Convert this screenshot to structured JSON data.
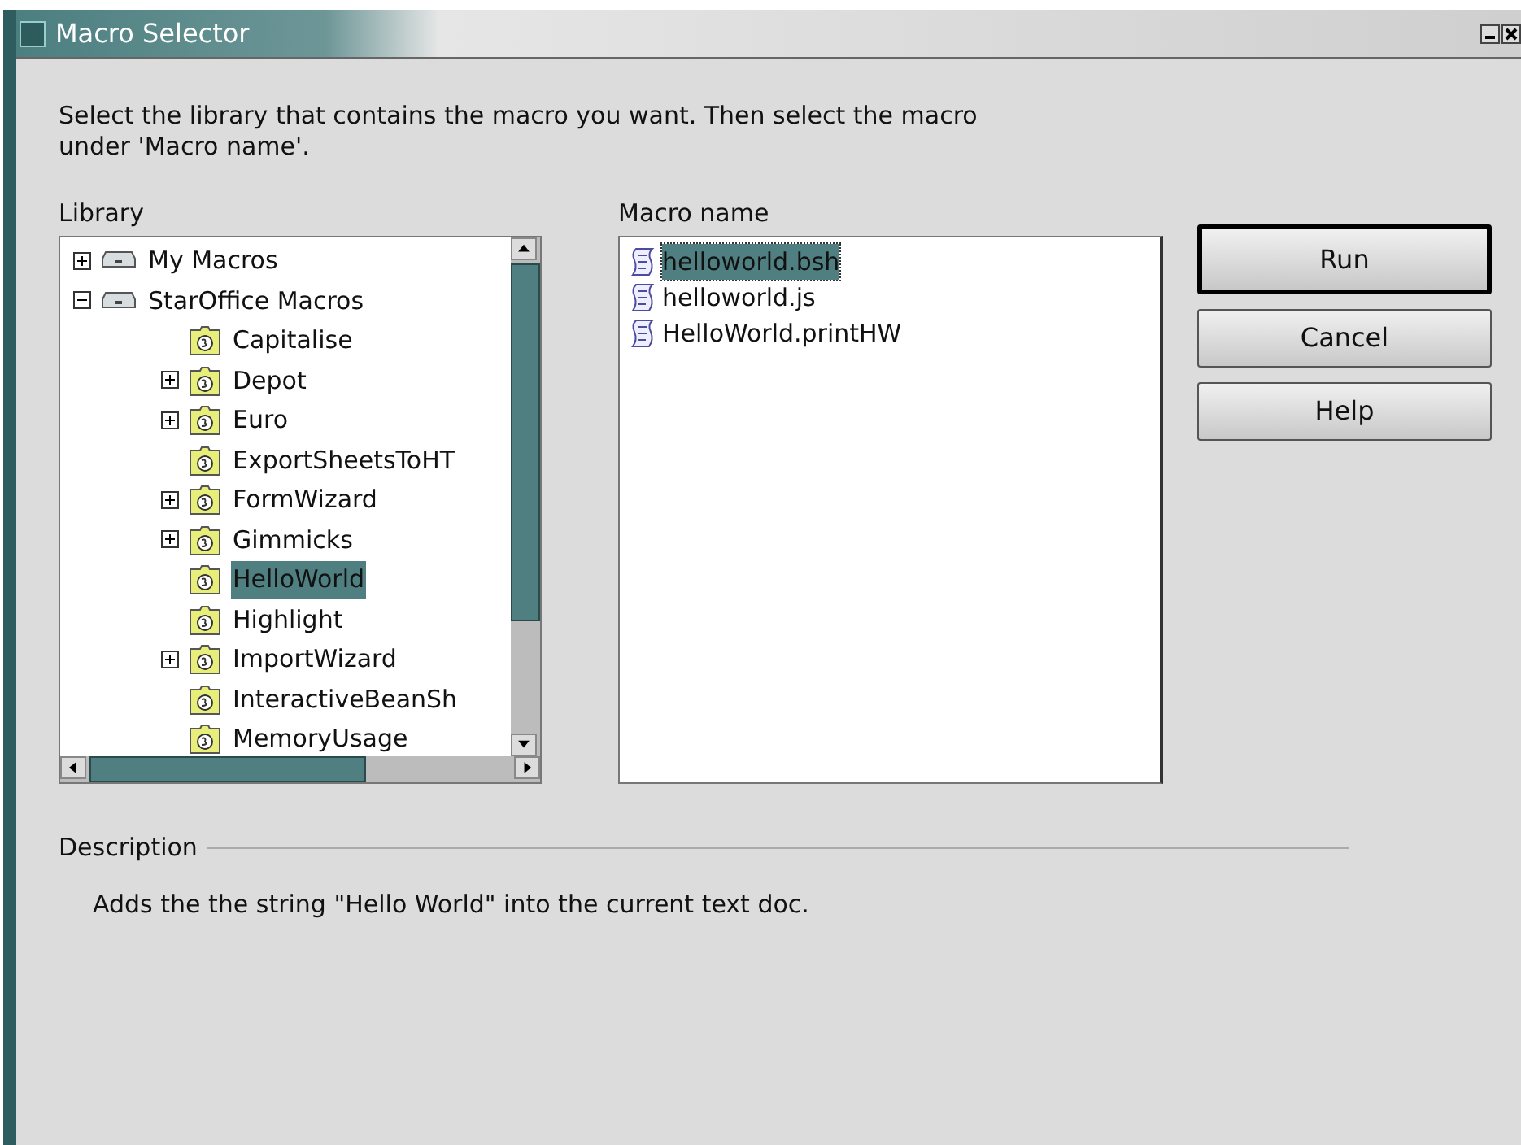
{
  "window": {
    "title": "Macro Selector"
  },
  "instructions": "Select the library that contains the macro you want. Then select the macro under 'Macro name'.",
  "library": {
    "label": "Library",
    "tree": [
      {
        "name": "My Macros",
        "kind": "container",
        "expanded": false,
        "selected": false
      },
      {
        "name": "StarOffice Macros",
        "kind": "container",
        "expanded": true,
        "selected": false,
        "children": [
          {
            "name": "Capitalise",
            "kind": "library",
            "selected": false
          },
          {
            "name": "Depot",
            "kind": "library",
            "expanded": false,
            "selected": false
          },
          {
            "name": "Euro",
            "kind": "library",
            "expanded": false,
            "selected": false
          },
          {
            "name": "ExportSheetsToHT",
            "kind": "library",
            "selected": false
          },
          {
            "name": "FormWizard",
            "kind": "library",
            "expanded": false,
            "selected": false
          },
          {
            "name": "Gimmicks",
            "kind": "library",
            "expanded": false,
            "selected": false
          },
          {
            "name": "HelloWorld",
            "kind": "library",
            "selected": true
          },
          {
            "name": "Highlight",
            "kind": "library",
            "selected": false
          },
          {
            "name": "ImportWizard",
            "kind": "library",
            "expanded": false,
            "selected": false
          },
          {
            "name": "InteractiveBeanSh",
            "kind": "library",
            "selected": false
          },
          {
            "name": "MemoryUsage",
            "kind": "library",
            "selected": false
          }
        ]
      }
    ]
  },
  "macros": {
    "label": "Macro name",
    "items": [
      {
        "name": "helloworld.bsh",
        "selected": true
      },
      {
        "name": "helloworld.js",
        "selected": false
      },
      {
        "name": "HelloWorld.printHW",
        "selected": false
      }
    ]
  },
  "buttons": [
    {
      "label": "Run",
      "default": true
    },
    {
      "label": "Cancel",
      "default": false
    },
    {
      "label": "Help",
      "default": false
    }
  ],
  "description": {
    "label": "Description",
    "text": "Adds the the string \"Hello World\" into the current text doc."
  }
}
